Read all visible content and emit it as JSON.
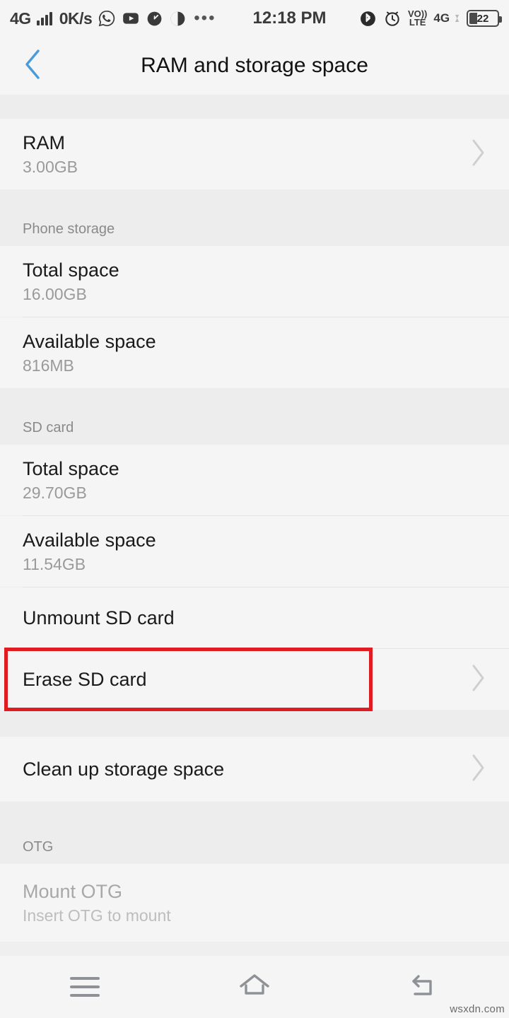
{
  "status_bar": {
    "network_type": "4G",
    "data_speed": "0K/s",
    "notification_icons": [
      "whatsapp-icon",
      "youtube-icon",
      "speedometer-icon",
      "half-circle-icon"
    ],
    "overflow": "•••",
    "time": "12:18 PM",
    "bluetooth_icon": "bluetooth-icon",
    "alarm_icon": "alarm-clock-icon",
    "volte_top": "VO))",
    "volte_bottom": "LTE",
    "sim_network": "4G",
    "battery_level": "22"
  },
  "header": {
    "back_icon": "chevron-left-icon",
    "title": "RAM and storage space"
  },
  "sections": [
    {
      "id": "ram",
      "header": "",
      "rows": [
        {
          "title": "RAM",
          "sub": "3.00GB",
          "chevron": true,
          "disabled": false
        }
      ]
    },
    {
      "id": "phone-storage",
      "header": "Phone storage",
      "rows": [
        {
          "title": "Total space",
          "sub": "16.00GB",
          "chevron": false,
          "disabled": false
        },
        {
          "title": "Available space",
          "sub": "816MB",
          "chevron": false,
          "disabled": false
        }
      ]
    },
    {
      "id": "sd-card",
      "header": "SD card",
      "rows": [
        {
          "title": "Total space",
          "sub": "29.70GB",
          "chevron": false,
          "disabled": false
        },
        {
          "title": "Available space",
          "sub": "11.54GB",
          "chevron": false,
          "disabled": false
        },
        {
          "title": "Unmount SD card",
          "sub": "",
          "chevron": false,
          "disabled": false
        },
        {
          "title": "Erase SD card",
          "sub": "",
          "chevron": true,
          "disabled": false,
          "highlighted": true
        }
      ]
    },
    {
      "id": "cleanup",
      "header": "",
      "rows": [
        {
          "title": "Clean up storage space",
          "sub": "",
          "chevron": true,
          "disabled": false
        }
      ]
    },
    {
      "id": "otg",
      "header": "OTG",
      "rows": [
        {
          "title": "Mount OTG",
          "sub": "Insert OTG to mount",
          "chevron": false,
          "disabled": true
        }
      ]
    }
  ],
  "annotation": {
    "color": "#e01b22",
    "target": "Erase SD card"
  },
  "nav_bar": {
    "menu_icon": "menu-icon",
    "home_icon": "home-icon",
    "back_icon": "back-arrow-icon"
  },
  "watermark": "wsxdn.com",
  "colors": {
    "row_bg": "#f5f5f5",
    "gap_bg": "#ededed",
    "accent_blue": "#4a9bd8",
    "annotation_red": "#e01b22",
    "primary_text": "#1a1a1a",
    "secondary_text": "#9a9a9a"
  }
}
